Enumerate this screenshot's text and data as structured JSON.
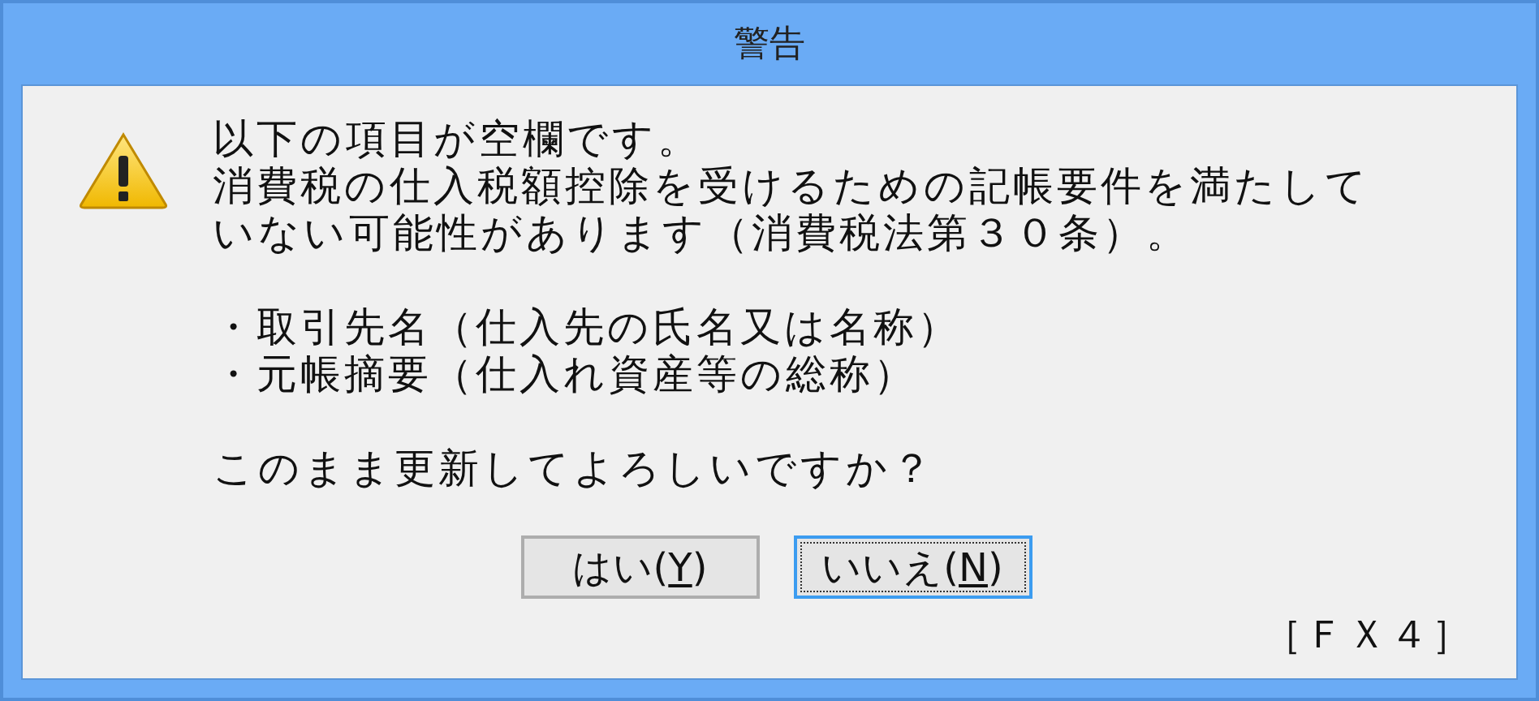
{
  "window": {
    "title": "警告"
  },
  "message": {
    "lines": [
      "以下の項目が空欄です。",
      "消費税の仕入税額控除を受けるための記帳要件を満たして",
      "いない可能性があります（消費税法第３０条）。"
    ],
    "items": [
      "・取引先名（仕入先の氏名又は名称）",
      "・元帳摘要（仕入れ資産等の総称）"
    ],
    "question": "このまま更新してよろしいですか？"
  },
  "buttons": [
    {
      "label_before": "はい(",
      "access_key": "Y",
      "label_after": ")",
      "focused": false
    },
    {
      "label_before": "いいえ(",
      "access_key": "N",
      "label_after": ")",
      "focused": true
    }
  ],
  "footer": "［ＦＸ４］"
}
